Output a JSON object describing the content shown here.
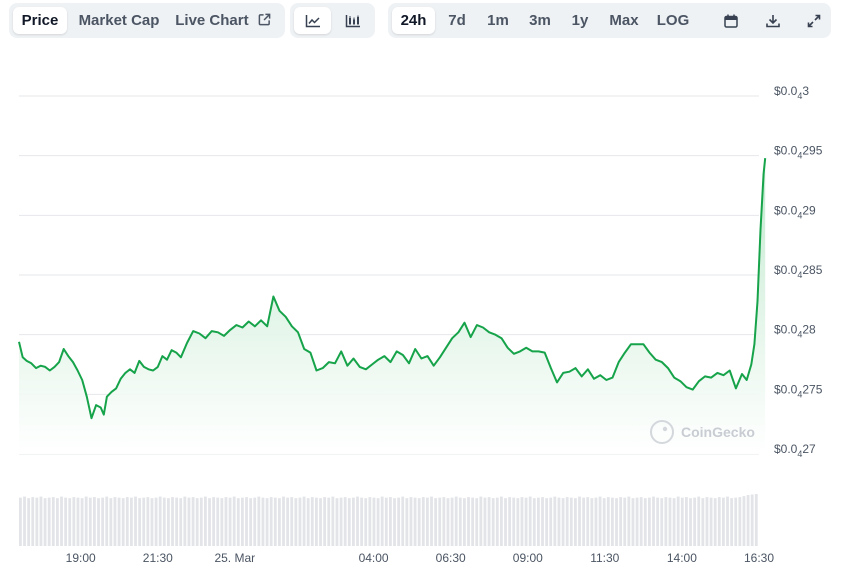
{
  "toolbar": {
    "tabs": [
      {
        "label": "Price",
        "active": true
      },
      {
        "label": "Market Cap",
        "active": false
      },
      {
        "label": "Live Chart",
        "active": false,
        "icon": "external-link-icon"
      }
    ],
    "chart_types": [
      {
        "icon": "line-chart-icon",
        "active": true
      },
      {
        "icon": "candlestick-chart-icon",
        "active": false
      }
    ],
    "ranges": [
      {
        "label": "24h",
        "active": true
      },
      {
        "label": "7d",
        "active": false
      },
      {
        "label": "1m",
        "active": false
      },
      {
        "label": "3m",
        "active": false
      },
      {
        "label": "1y",
        "active": false
      },
      {
        "label": "Max",
        "active": false
      },
      {
        "label": "LOG",
        "active": false
      }
    ],
    "tools": [
      {
        "icon": "calendar-icon"
      },
      {
        "icon": "download-icon"
      },
      {
        "icon": "fullscreen-icon"
      }
    ]
  },
  "watermark": "CoinGecko",
  "colors": {
    "line": "#16a34a",
    "area_top": "#bfe8cc",
    "grid": "#e5e7eb",
    "volume": "#e2e4e8",
    "button_bg": "#eff2f5"
  },
  "chart_data": {
    "type": "area",
    "x_tick_labels": [
      "19:00",
      "21:30",
      "25. Mar",
      "04:00",
      "06:30",
      "09:00",
      "11:30",
      "14:00",
      "16:30"
    ],
    "y_tick_labels": [
      {
        "prefix": "$0.0",
        "sub": "4",
        "suffix": "3"
      },
      {
        "prefix": "$0.0",
        "sub": "4",
        "suffix": "295"
      },
      {
        "prefix": "$0.0",
        "sub": "4",
        "suffix": "29"
      },
      {
        "prefix": "$0.0",
        "sub": "4",
        "suffix": "285"
      },
      {
        "prefix": "$0.0",
        "sub": "4",
        "suffix": "28"
      },
      {
        "prefix": "$0.0",
        "sub": "4",
        "suffix": "275"
      },
      {
        "prefix": "$0.0",
        "sub": "4",
        "suffix": "27"
      }
    ],
    "y_scale_unit": "1e-5",
    "y_range": [
      2.7,
      3.0
    ],
    "y_ticks": [
      3.0,
      2.95,
      2.9,
      2.85,
      2.8,
      2.75,
      2.7
    ],
    "x_range": [
      0,
      24
    ],
    "x_tick_values": [
      2.0,
      4.5,
      7.0,
      11.5,
      14.0,
      16.5,
      19.0,
      21.5,
      24.0
    ],
    "grid": true,
    "price": [
      [
        0.0,
        2.794
      ],
      [
        0.12,
        2.781
      ],
      [
        0.25,
        2.778
      ],
      [
        0.4,
        2.776
      ],
      [
        0.55,
        2.772
      ],
      [
        0.7,
        2.774
      ],
      [
        0.85,
        2.773
      ],
      [
        1.0,
        2.77
      ],
      [
        1.15,
        2.773
      ],
      [
        1.3,
        2.777
      ],
      [
        1.45,
        2.788
      ],
      [
        1.6,
        2.782
      ],
      [
        1.75,
        2.777
      ],
      [
        1.9,
        2.77
      ],
      [
        2.05,
        2.762
      ],
      [
        2.2,
        2.748
      ],
      [
        2.35,
        2.73
      ],
      [
        2.5,
        2.741
      ],
      [
        2.65,
        2.739
      ],
      [
        2.75,
        2.733
      ],
      [
        2.85,
        2.748
      ],
      [
        3.0,
        2.752
      ],
      [
        3.15,
        2.755
      ],
      [
        3.3,
        2.763
      ],
      [
        3.45,
        2.768
      ],
      [
        3.6,
        2.771
      ],
      [
        3.75,
        2.768
      ],
      [
        3.9,
        2.778
      ],
      [
        4.05,
        2.773
      ],
      [
        4.2,
        2.771
      ],
      [
        4.35,
        2.77
      ],
      [
        4.5,
        2.773
      ],
      [
        4.65,
        2.782
      ],
      [
        4.8,
        2.779
      ],
      [
        4.95,
        2.787
      ],
      [
        5.1,
        2.785
      ],
      [
        5.25,
        2.781
      ],
      [
        5.45,
        2.793
      ],
      [
        5.65,
        2.803
      ],
      [
        5.85,
        2.801
      ],
      [
        6.05,
        2.797
      ],
      [
        6.25,
        2.803
      ],
      [
        6.45,
        2.802
      ],
      [
        6.65,
        2.799
      ],
      [
        6.85,
        2.804
      ],
      [
        7.05,
        2.808
      ],
      [
        7.25,
        2.806
      ],
      [
        7.45,
        2.811
      ],
      [
        7.65,
        2.807
      ],
      [
        7.85,
        2.812
      ],
      [
        8.05,
        2.807
      ],
      [
        8.25,
        2.832
      ],
      [
        8.45,
        2.82
      ],
      [
        8.65,
        2.815
      ],
      [
        8.85,
        2.807
      ],
      [
        9.05,
        2.802
      ],
      [
        9.25,
        2.788
      ],
      [
        9.45,
        2.785
      ],
      [
        9.65,
        2.77
      ],
      [
        9.85,
        2.772
      ],
      [
        10.05,
        2.777
      ],
      [
        10.25,
        2.776
      ],
      [
        10.45,
        2.786
      ],
      [
        10.65,
        2.774
      ],
      [
        10.85,
        2.78
      ],
      [
        11.05,
        2.773
      ],
      [
        11.25,
        2.771
      ],
      [
        11.45,
        2.775
      ],
      [
        11.65,
        2.779
      ],
      [
        11.85,
        2.782
      ],
      [
        12.05,
        2.777
      ],
      [
        12.25,
        2.786
      ],
      [
        12.45,
        2.783
      ],
      [
        12.65,
        2.776
      ],
      [
        12.85,
        2.788
      ],
      [
        13.05,
        2.78
      ],
      [
        13.25,
        2.782
      ],
      [
        13.45,
        2.774
      ],
      [
        13.65,
        2.781
      ],
      [
        13.85,
        2.789
      ],
      [
        14.05,
        2.797
      ],
      [
        14.25,
        2.802
      ],
      [
        14.45,
        2.81
      ],
      [
        14.65,
        2.798
      ],
      [
        14.85,
        2.808
      ],
      [
        15.05,
        2.806
      ],
      [
        15.25,
        2.802
      ],
      [
        15.45,
        2.8
      ],
      [
        15.65,
        2.797
      ],
      [
        15.85,
        2.789
      ],
      [
        16.05,
        2.784
      ],
      [
        16.25,
        2.786
      ],
      [
        16.45,
        2.789
      ],
      [
        16.65,
        2.786
      ],
      [
        16.85,
        2.786
      ],
      [
        17.05,
        2.785
      ],
      [
        17.25,
        2.772
      ],
      [
        17.45,
        2.76
      ],
      [
        17.65,
        2.768
      ],
      [
        17.85,
        2.769
      ],
      [
        18.05,
        2.772
      ],
      [
        18.25,
        2.765
      ],
      [
        18.45,
        2.771
      ],
      [
        18.65,
        2.763
      ],
      [
        18.85,
        2.766
      ],
      [
        19.05,
        2.762
      ],
      [
        19.25,
        2.764
      ],
      [
        19.45,
        2.777
      ],
      [
        19.65,
        2.785
      ],
      [
        19.85,
        2.792
      ],
      [
        20.05,
        2.792
      ],
      [
        20.25,
        2.792
      ],
      [
        20.45,
        2.785
      ],
      [
        20.65,
        2.779
      ],
      [
        20.85,
        2.777
      ],
      [
        21.05,
        2.772
      ],
      [
        21.25,
        2.764
      ],
      [
        21.45,
        2.761
      ],
      [
        21.65,
        2.756
      ],
      [
        21.85,
        2.754
      ],
      [
        22.05,
        2.761
      ],
      [
        22.25,
        2.765
      ],
      [
        22.45,
        2.764
      ],
      [
        22.65,
        2.768
      ],
      [
        22.85,
        2.766
      ],
      [
        23.05,
        2.77
      ],
      [
        23.25,
        2.755
      ],
      [
        23.45,
        2.767
      ],
      [
        23.6,
        2.762
      ],
      [
        23.75,
        2.775
      ],
      [
        23.85,
        2.792
      ],
      [
        23.95,
        2.828
      ],
      [
        24.05,
        2.888
      ],
      [
        24.15,
        2.935
      ],
      [
        24.2,
        2.948
      ]
    ],
    "volume": [
      0.93,
      0.95,
      0.92,
      0.94,
      0.93,
      0.95,
      0.92,
      0.93,
      0.94,
      0.92,
      0.95,
      0.93,
      0.92,
      0.94,
      0.93,
      0.92,
      0.95,
      0.93,
      0.94,
      0.92,
      0.93,
      0.95,
      0.92,
      0.94,
      0.93,
      0.92,
      0.94,
      0.93,
      0.95,
      0.92,
      0.93,
      0.94,
      0.92,
      0.93,
      0.95,
      0.93,
      0.92,
      0.94,
      0.93,
      0.92,
      0.95,
      0.93,
      0.94,
      0.92,
      0.93,
      0.95,
      0.92,
      0.94,
      0.93,
      0.92,
      0.94,
      0.93,
      0.95,
      0.92,
      0.93,
      0.94,
      0.92,
      0.93,
      0.95,
      0.93,
      0.92,
      0.94,
      0.93,
      0.92,
      0.95,
      0.93,
      0.94,
      0.92,
      0.93,
      0.95,
      0.92,
      0.94,
      0.93,
      0.92,
      0.94,
      0.93,
      0.95,
      0.92,
      0.93,
      0.94,
      0.92,
      0.93,
      0.95,
      0.93,
      0.92,
      0.94,
      0.93,
      0.92,
      0.95,
      0.93,
      0.94,
      0.92,
      0.93,
      0.95,
      0.92,
      0.94,
      0.93,
      0.92,
      0.94,
      0.93,
      0.95,
      0.92,
      0.93,
      0.94,
      0.92,
      0.93,
      0.95,
      0.93,
      0.92,
      0.94,
      0.93,
      0.92,
      0.95,
      0.93,
      0.94,
      0.92,
      0.93,
      0.95,
      0.92,
      0.94,
      0.93,
      0.92,
      0.94,
      0.93,
      0.95,
      0.92,
      0.93,
      0.94,
      0.92,
      0.93,
      0.95,
      0.93,
      0.92,
      0.94,
      0.93,
      0.92,
      0.95,
      0.93,
      0.94,
      0.92,
      0.93,
      0.95,
      0.92,
      0.94,
      0.93,
      0.92,
      0.94,
      0.93,
      0.95,
      0.92,
      0.93,
      0.94,
      0.92,
      0.93,
      0.95,
      0.93,
      0.92,
      0.94,
      0.93,
      0.92,
      0.95,
      0.93,
      0.94,
      0.92,
      0.93,
      0.95,
      0.92,
      0.94,
      0.93,
      0.92,
      0.94,
      0.93,
      0.95,
      0.92,
      0.93,
      0.94,
      0.96,
      0.98,
      0.99,
      1.0
    ]
  }
}
